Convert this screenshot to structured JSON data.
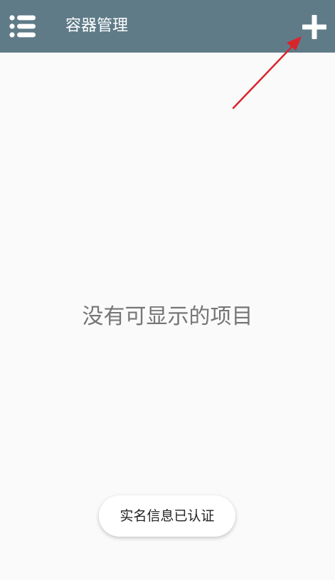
{
  "app_bar": {
    "title": "容器管理",
    "background_color": "#5f7b88",
    "menu_icon": "list-menu-icon",
    "add_icon": "plus-icon"
  },
  "main": {
    "empty_message": "没有可显示的项目"
  },
  "toast": {
    "message": "实名信息已认证"
  },
  "annotation": {
    "arrow_color": "#d9242b"
  }
}
